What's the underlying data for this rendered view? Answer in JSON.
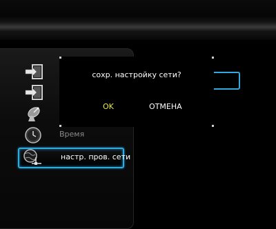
{
  "sidebar": {
    "items": [
      {
        "icon": "input-arrow-icon",
        "label": ""
      },
      {
        "icon": "input-arrow-icon",
        "label": ""
      },
      {
        "icon": "satellite-dish-icon",
        "label": ""
      },
      {
        "icon": "clock-icon",
        "label": "Время"
      },
      {
        "icon": "network-globe-icon",
        "label": "настр. пров. сети"
      }
    ]
  },
  "dialog": {
    "message": "сохр. настройку сети?",
    "ok_label": "OK",
    "cancel_label": "ОТМЕНА"
  },
  "colors": {
    "accent": "#33aadd",
    "ok_text": "#e8e84a",
    "background": "#000000"
  }
}
